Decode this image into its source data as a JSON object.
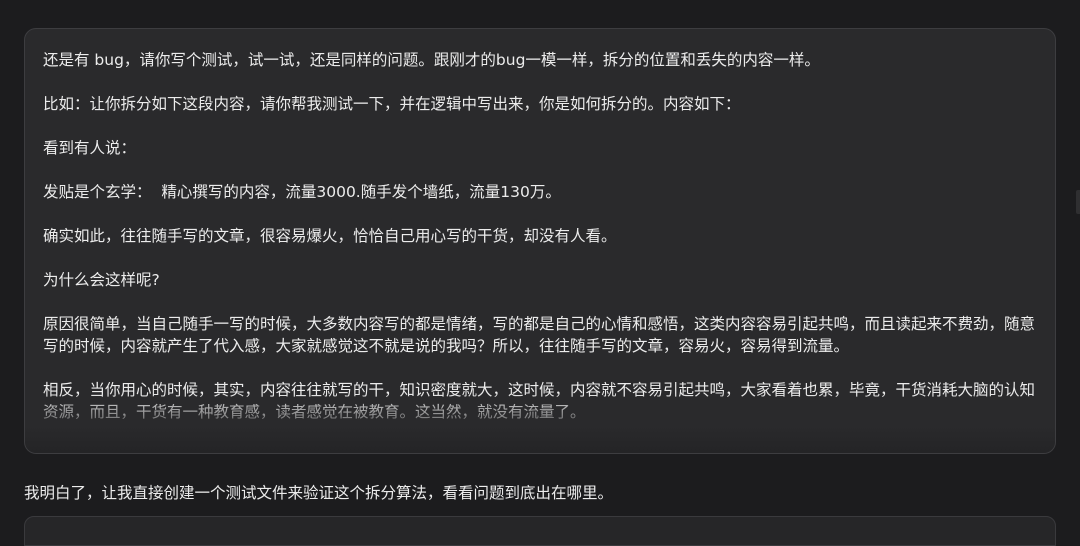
{
  "user_message": {
    "paragraphs": [
      "还是有 bug，请你写个测试，试一试，还是同样的问题。跟刚才的bug一模一样，拆分的位置和丢失的内容一样。",
      "比如：让你拆分如下这段内容，请你帮我测试一下，并在逻辑中写出来，你是如何拆分的。内容如下：",
      "看到有人说：",
      "发贴是个玄学：  精心撰写的内容，流量3000.随手发个墙纸，流量130万。",
      "确实如此，往往随手写的文章，很容易爆火，恰恰自己用心写的干货，却没有人看。",
      "为什么会这样呢?",
      "原因很简单，当自己随手一写的时候，大多数内容写的都是情绪，写的都是自己的心情和感悟，这类内容容易引起共鸣，而且读起来不费劲，随意写的时候，内容就产生了代入感，大家就感觉这不就是说的我吗？所以，往往随手写的文章，容易火，容易得到流量。",
      "相反，当你用心的时候，其实，内容往往就写的干，知识密度就大，这时候，内容就不容易引起共鸣，大家看着也累，毕竟，干货消耗大脑的认知资源，而且，干货有一种教育感，读者感觉在被教育。这当然，就没有流量了。"
    ]
  },
  "assistant_message": {
    "text": "我明白了，让我直接创建一个测试文件来验证这个拆分算法，看看问题到底出在哪里。"
  }
}
